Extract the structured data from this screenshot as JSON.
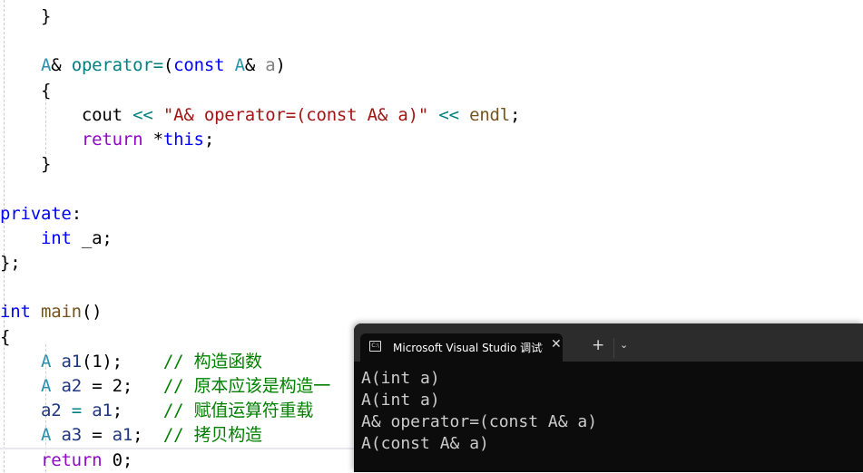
{
  "editor": {
    "lines": [
      {
        "parts": [
          [
            "}",
            ""
          ]
        ],
        "indent": "    "
      },
      {
        "parts": [],
        "indent": ""
      },
      {
        "parts": [
          [
            "A",
            "ty"
          ],
          [
            "& ",
            ""
          ],
          [
            "operator=",
            "fn"
          ],
          [
            "(",
            ""
          ],
          [
            "const",
            "kw"
          ],
          [
            " ",
            ""
          ],
          [
            "A",
            "ty"
          ],
          [
            "& ",
            ""
          ],
          [
            "a",
            "pa"
          ],
          [
            ")",
            ""
          ]
        ],
        "indent": "    "
      },
      {
        "parts": [
          [
            "{",
            ""
          ]
        ],
        "indent": "    "
      },
      {
        "parts": [
          [
            "cout",
            ""
          ],
          [
            " ",
            ""
          ],
          [
            "<<",
            "op"
          ],
          [
            " ",
            ""
          ],
          [
            "\"A& operator=(const A& a)\"",
            "st"
          ],
          [
            " ",
            ""
          ],
          [
            "<<",
            "op"
          ],
          [
            " ",
            ""
          ],
          [
            "endl",
            "mf"
          ],
          [
            ";",
            ""
          ]
        ],
        "indent": "        "
      },
      {
        "parts": [
          [
            "return",
            "pu"
          ],
          [
            " *",
            ""
          ],
          [
            "this",
            "kw"
          ],
          [
            ";",
            ""
          ]
        ],
        "indent": "        "
      },
      {
        "parts": [
          [
            "}",
            ""
          ]
        ],
        "indent": "    "
      },
      {
        "parts": [],
        "indent": ""
      },
      {
        "parts": [
          [
            "private",
            "kw"
          ],
          [
            ":",
            ""
          ]
        ],
        "indent": ""
      },
      {
        "parts": [
          [
            "int",
            "kw"
          ],
          [
            " _a;",
            ""
          ]
        ],
        "indent": "    "
      },
      {
        "parts": [
          [
            "};",
            ""
          ]
        ],
        "indent": ""
      },
      {
        "parts": [],
        "indent": ""
      },
      {
        "parts": [
          [
            "int",
            "kw"
          ],
          [
            " ",
            ""
          ],
          [
            "main",
            "mf"
          ],
          [
            "()",
            ""
          ]
        ],
        "indent": ""
      },
      {
        "parts": [
          [
            "{",
            ""
          ]
        ],
        "indent": ""
      },
      {
        "parts": [
          [
            "A",
            "ty"
          ],
          [
            " ",
            ""
          ],
          [
            "a1",
            "va"
          ],
          [
            "(1);    ",
            ""
          ],
          [
            "// 构造函数",
            "cm"
          ]
        ],
        "indent": "    "
      },
      {
        "parts": [
          [
            "A",
            "ty"
          ],
          [
            " ",
            ""
          ],
          [
            "a2",
            "va"
          ],
          [
            " = 2;   ",
            ""
          ],
          [
            "// 原本应该是构造一",
            "cm"
          ]
        ],
        "indent": "    "
      },
      {
        "parts": [
          [
            "a2",
            "va"
          ],
          [
            " ",
            ""
          ],
          [
            "=",
            "op"
          ],
          [
            " ",
            ""
          ],
          [
            "a1",
            "va"
          ],
          [
            ";    ",
            ""
          ],
          [
            "// 赋值运算符重载",
            "cm"
          ]
        ],
        "indent": "    "
      },
      {
        "parts": [
          [
            "A",
            "ty"
          ],
          [
            " ",
            ""
          ],
          [
            "a3",
            "va"
          ],
          [
            " = ",
            ""
          ],
          [
            "a1",
            "va"
          ],
          [
            ";  ",
            ""
          ],
          [
            "// 拷贝构造",
            "cm"
          ]
        ],
        "indent": "    "
      },
      {
        "parts": [
          [
            "return",
            "pu"
          ],
          [
            " 0;",
            ""
          ]
        ],
        "indent": "    "
      }
    ]
  },
  "terminal": {
    "tab_title": "Microsoft Visual Studio 调试控制台",
    "icon": "terminal-icon",
    "icon_text": "C:\\",
    "close_glyph": "✕",
    "new_tab_glyph": "+",
    "dropdown_glyph": "⌄",
    "output": [
      "A(int a)",
      "A(int a)",
      "A& operator=(const A& a)",
      "A(const A& a)"
    ]
  }
}
